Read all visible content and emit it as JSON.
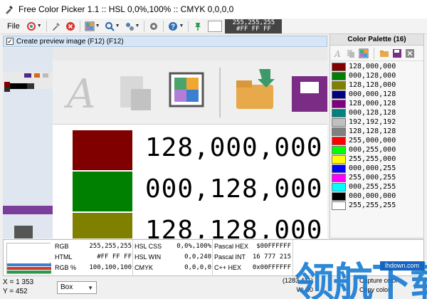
{
  "window": {
    "title": "Free Color Picker 1.1  ::  HSL 0,0%,100%  ::  CMYK 0,0,0,0"
  },
  "toolbar": {
    "file_label": "File",
    "readout_rgb": "255,255,255",
    "readout_hex": "#FF FF FF",
    "icons": [
      "color-brush-icon",
      "eyedropper-icon",
      "close-icon",
      "palette-icon",
      "magnifier-icon",
      "tools-icon",
      "gear-icon",
      "help-icon",
      "pin-icon"
    ]
  },
  "preview": {
    "checked": true,
    "label": "Create preview image (F12) (F12)"
  },
  "zoom_preview": {
    "rows": [
      {
        "text": "128,000,000",
        "color": "#800000"
      },
      {
        "text": "000,128,000",
        "color": "#008000"
      },
      {
        "text": "128,128,000",
        "color": "#808000"
      }
    ]
  },
  "palette": {
    "title": "Color Palette (16)",
    "items": [
      {
        "value": "128,000,000",
        "color": "#800000"
      },
      {
        "value": "000,128,000",
        "color": "#008000"
      },
      {
        "value": "128,128,000",
        "color": "#808000"
      },
      {
        "value": "000,000,128",
        "color": "#000080"
      },
      {
        "value": "128,000,128",
        "color": "#800080"
      },
      {
        "value": "000,128,128",
        "color": "#008080"
      },
      {
        "value": "192,192,192",
        "color": "#c0c0c0"
      },
      {
        "value": "128,128,128",
        "color": "#808080"
      },
      {
        "value": "255,000,000",
        "color": "#ff0000"
      },
      {
        "value": "000,255,000",
        "color": "#00ff00"
      },
      {
        "value": "255,255,000",
        "color": "#ffff00"
      },
      {
        "value": "000,000,255",
        "color": "#0000ff"
      },
      {
        "value": "255,000,255",
        "color": "#ff00ff"
      },
      {
        "value": "000,255,255",
        "color": "#00ffff"
      },
      {
        "value": "000,000,000",
        "color": "#000000"
      },
      {
        "value": "255,255,255",
        "color": "#ffffff"
      }
    ]
  },
  "info": {
    "col1": [
      {
        "key": "RGB",
        "value": "255,255,255"
      },
      {
        "key": "HTML",
        "value": "#FF FF FF"
      },
      {
        "key": "RGB %",
        "value": "100,100,100"
      }
    ],
    "col2": [
      {
        "key": "HSL CSS",
        "value": "0,0%,100%"
      },
      {
        "key": "HSL WIN",
        "value": "0,0,240"
      },
      {
        "key": "CMYK",
        "value": "0,0,0,0"
      }
    ],
    "col3": [
      {
        "key": "Pascal HEX",
        "value": "$00FFFFFF"
      },
      {
        "key": "Pascal INT",
        "value": "16 777 215"
      },
      {
        "key": "C++ HEX",
        "value": "0x00FFFFFF"
      }
    ]
  },
  "status": {
    "x": "X = 1 353",
    "y": "Y = 452",
    "box_label": "Box",
    "position": "(1283,411)",
    "wh": "W: 40",
    "capture_shortcut": "Capture color",
    "copy_shortcut": "Copy color"
  },
  "watermark": {
    "text": "领航下载",
    "url": "lhdown.com"
  }
}
